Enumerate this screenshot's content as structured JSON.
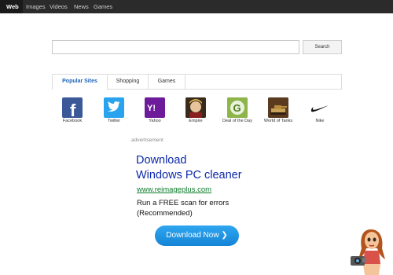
{
  "nav": {
    "items": [
      {
        "label": "Web",
        "active": true
      },
      {
        "label": "Images",
        "active": false
      },
      {
        "label": "Videos",
        "active": false
      },
      {
        "label": "News",
        "active": false
      },
      {
        "label": "Games",
        "active": false
      }
    ]
  },
  "search": {
    "value": "",
    "button_label": "Search"
  },
  "tabs": [
    {
      "label": "Popular Sites",
      "active": true
    },
    {
      "label": "Shopping",
      "active": false
    },
    {
      "label": "Games",
      "active": false
    }
  ],
  "sites": [
    {
      "label": "Facebook",
      "icon": "facebook-icon"
    },
    {
      "label": "Twitter",
      "icon": "twitter-icon"
    },
    {
      "label": "Yahoo",
      "icon": "yahoo-icon"
    },
    {
      "label": "Empire",
      "icon": "empire-icon"
    },
    {
      "label": "Deal of the Day",
      "icon": "deal-of-the-day-icon"
    },
    {
      "label": "World of Tanks",
      "icon": "world-of-tanks-icon"
    },
    {
      "label": "Nike",
      "icon": "nike-icon"
    }
  ],
  "ad": {
    "label": "advertisement",
    "title_line1": "Download",
    "title_line2": "Windows PC cleaner",
    "url": "www.reimageplus.com",
    "body_line1": "Run a FREE scan for errors",
    "body_line2": "(Recommended)",
    "button_label": "Download Now ❯"
  },
  "colors": {
    "topbar": "#2b2b2b",
    "accent_tab": "#1a64b8",
    "ad_title": "#0b28a8",
    "ad_url": "#0b7a2a",
    "ad_button": "#1e97e6"
  }
}
